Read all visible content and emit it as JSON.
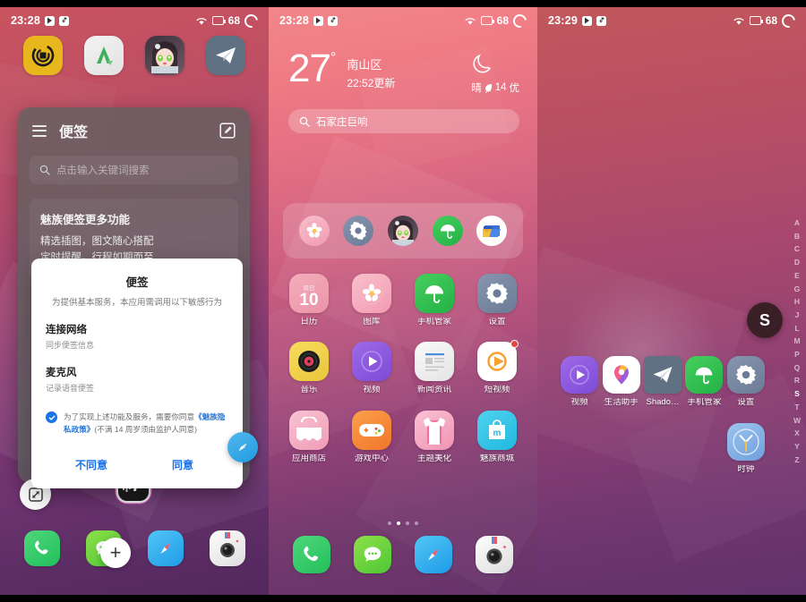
{
  "screens": [
    {
      "id": "screen-1-notes-permission",
      "statusbar": {
        "time": "23:28",
        "battery": "68",
        "icons": [
          "play-store-icon",
          "tiktok-icon",
          "wifi-icon",
          "signal-icon",
          "battery-ring-icon"
        ]
      },
      "top_row_apps": [
        {
          "name": "yellow-scanner-app",
          "label": ""
        },
        {
          "name": "apkpure-app",
          "label": ""
        },
        {
          "name": "anime-avatar-app",
          "label": ""
        },
        {
          "name": "telegram-app",
          "label": ""
        }
      ],
      "notes_app": {
        "title": "便签",
        "menu_icon": "hamburger-icon",
        "compose_icon": "edit-square-icon",
        "search_placeholder": "点击输入关键词搜索",
        "search_icon": "search-icon",
        "card": {
          "title": "魅族便签更多功能",
          "line1": "精选插图，图文随心搭配",
          "line2": "定时提醒，行程如期而至"
        }
      },
      "dialog": {
        "title": "便签",
        "subtitle": "为提供基本服务，本应用需调用以下敏感行为",
        "permissions": [
          {
            "name": "连接网络",
            "desc": "同步便签信息"
          },
          {
            "name": "麦克风",
            "desc": "记录语音便签"
          }
        ],
        "consent_prefix": "为了实现上述功能及服务，需要你同意",
        "consent_link": "《魅族隐私政策》",
        "consent_suffix": "(不满 14 周岁须由监护人同意)",
        "checkbox_checked": true,
        "buttons": {
          "decline": "不同意",
          "accept": "同意"
        }
      },
      "floating": [
        {
          "name": "screenshot-float-button",
          "icon": "screenshot-icon"
        },
        {
          "name": "mf-app-float",
          "label": "F"
        },
        {
          "name": "compass-float-button",
          "icon": "compass-icon"
        },
        {
          "name": "add-float-button",
          "label": "+"
        }
      ],
      "dock": [
        {
          "name": "phone-app",
          "label": ""
        },
        {
          "name": "messages-app",
          "label": ""
        },
        {
          "name": "browser-app",
          "label": ""
        },
        {
          "name": "camera-app",
          "label": ""
        }
      ]
    },
    {
      "id": "screen-2-home",
      "statusbar": {
        "time": "23:28",
        "battery": "68"
      },
      "weather": {
        "temperature": "27",
        "degree_symbol": "°",
        "city": "南山区",
        "updated": "22:52更新",
        "condition": "晴",
        "aqi_value": "14",
        "aqi_level": "优",
        "moon_icon": "crescent-moon-icon"
      },
      "search": {
        "icon": "search-icon",
        "text": "石家庄巨响"
      },
      "folder_row": [
        {
          "name": "gallery-flower-icon"
        },
        {
          "name": "settings-gear-icon"
        },
        {
          "name": "anime-avatar-icon"
        },
        {
          "name": "security-umbrella-icon"
        },
        {
          "name": "file-manager-icon"
        }
      ],
      "apps": [
        {
          "label": "日历",
          "icon": "calendar-icon",
          "weekday": "周日",
          "day": "10"
        },
        {
          "label": "图库",
          "icon": "gallery-icon"
        },
        {
          "label": "手机管家",
          "icon": "phone-manager-icon"
        },
        {
          "label": "设置",
          "icon": "settings-icon"
        },
        {
          "label": "音乐",
          "icon": "music-icon"
        },
        {
          "label": "视频",
          "icon": "video-icon"
        },
        {
          "label": "新闻资讯",
          "icon": "news-icon"
        },
        {
          "label": "短视频",
          "icon": "short-video-icon",
          "badge": true
        },
        {
          "label": "应用商店",
          "icon": "app-store-icon"
        },
        {
          "label": "游戏中心",
          "icon": "game-center-icon"
        },
        {
          "label": "主题美化",
          "icon": "theme-icon"
        },
        {
          "label": "魅族商城",
          "icon": "meizu-mall-icon"
        }
      ],
      "page_dots": {
        "count": 4,
        "active_index": 1
      },
      "dock": [
        {
          "name": "phone-app"
        },
        {
          "name": "messages-app"
        },
        {
          "name": "browser-app"
        },
        {
          "name": "camera-app"
        }
      ]
    },
    {
      "id": "screen-3-app-drawer",
      "statusbar": {
        "time": "23:29",
        "battery": "68"
      },
      "index_letters": [
        "A",
        "B",
        "C",
        "D",
        "E",
        "G",
        "H",
        "J",
        "L",
        "M",
        "P",
        "Q",
        "R",
        "S",
        "T",
        "W",
        "X",
        "Y",
        "Z"
      ],
      "selected_letter": "S",
      "bubble_letter": "S",
      "apps": [
        {
          "label": "视频",
          "icon": "video-icon"
        },
        {
          "label": "生活助手",
          "icon": "life-assistant-icon"
        },
        {
          "label": "Shado…",
          "icon": "shadowsocks-icon"
        },
        {
          "label": "手机管家",
          "icon": "phone-manager-icon"
        },
        {
          "label": "设置",
          "icon": "settings-icon"
        },
        {
          "label": "时钟",
          "icon": "clock-icon"
        }
      ]
    }
  ]
}
